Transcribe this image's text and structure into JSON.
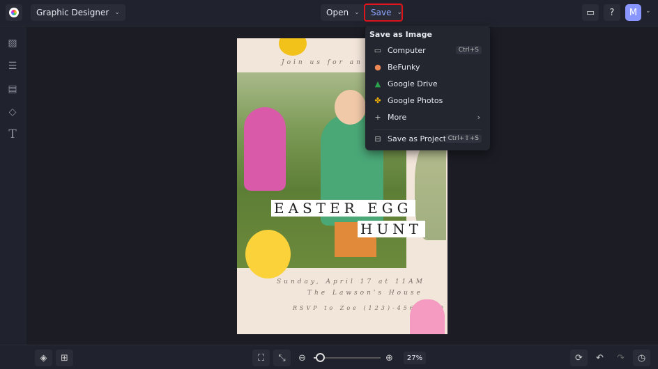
{
  "app": {
    "title": "Graphic Designer",
    "open_label": "Open",
    "save_label": "Save",
    "avatar_initial": "M"
  },
  "save_menu": {
    "header": "Save as Image",
    "items": [
      {
        "label": "Computer",
        "shortcut": "Ctrl+S",
        "icon": "monitor-icon"
      },
      {
        "label": "BeFunky",
        "icon": "befunky-icon"
      },
      {
        "label": "Google Drive",
        "icon": "google-drive-icon"
      },
      {
        "label": "Google Photos",
        "icon": "google-photos-icon"
      },
      {
        "label": "More",
        "icon": "plus-icon"
      },
      {
        "label": "Save as Project",
        "shortcut": "Ctrl+⇧+S",
        "icon": "briefcase-icon"
      }
    ]
  },
  "poster": {
    "invite": "Join us for an egg",
    "title1": "EASTER EGG",
    "title2": "HUNT",
    "date": "Sunday, April 17 at 11AM",
    "place": "The Lawson's House",
    "rsvp": "RSVP to Zoe (123)-456-7890"
  },
  "zoom": {
    "value": "27%",
    "level": 0.05
  }
}
